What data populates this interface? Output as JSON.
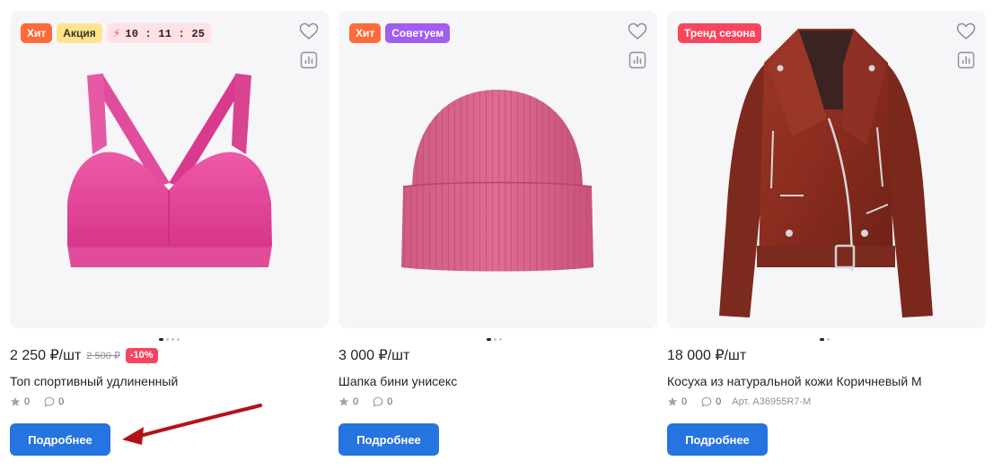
{
  "products": [
    {
      "badges": {
        "hit": "Хит",
        "promo": "Акция",
        "timer": "10 : 11 : 25"
      },
      "price": "2 250 ₽/шт",
      "old_price": "2 500 ₽",
      "discount": "-10%",
      "title": "Топ спортивный удлиненный",
      "rating": "0",
      "reviews": "0",
      "button": "Подробнее",
      "image": "pink-sports-bra"
    },
    {
      "badges": {
        "hit": "Хит",
        "advise": "Советуем"
      },
      "price": "3 000 ₽/шт",
      "title": "Шапка бини унисекс",
      "rating": "0",
      "reviews": "0",
      "button": "Подробнее",
      "image": "pink-beanie"
    },
    {
      "badges": {
        "trend": "Тренд сезона"
      },
      "price": "18 000 ₽/шт",
      "title": "Косуха из натуральной кожи Коричневый M",
      "rating": "0",
      "reviews": "0",
      "sku": "Арт. A36955R7-M",
      "button": "Подробнее",
      "image": "brown-leather-jacket"
    }
  ],
  "icons": {
    "favorite": "heart-icon",
    "compare": "chart-bar-icon",
    "rating": "star-icon",
    "reviews": "chat-bubble-icon",
    "timer": "lightning-icon",
    "annotation": "red-arrow-icon"
  },
  "colors": {
    "accent": "#2674e0",
    "badge_hit": "#ff6a3a",
    "badge_promo": "#ffe48d",
    "badge_advise": "#a15cf0",
    "badge_trend": "#f8455f",
    "discount": "#f8455f",
    "annotation_arrow": "#b3121a"
  }
}
